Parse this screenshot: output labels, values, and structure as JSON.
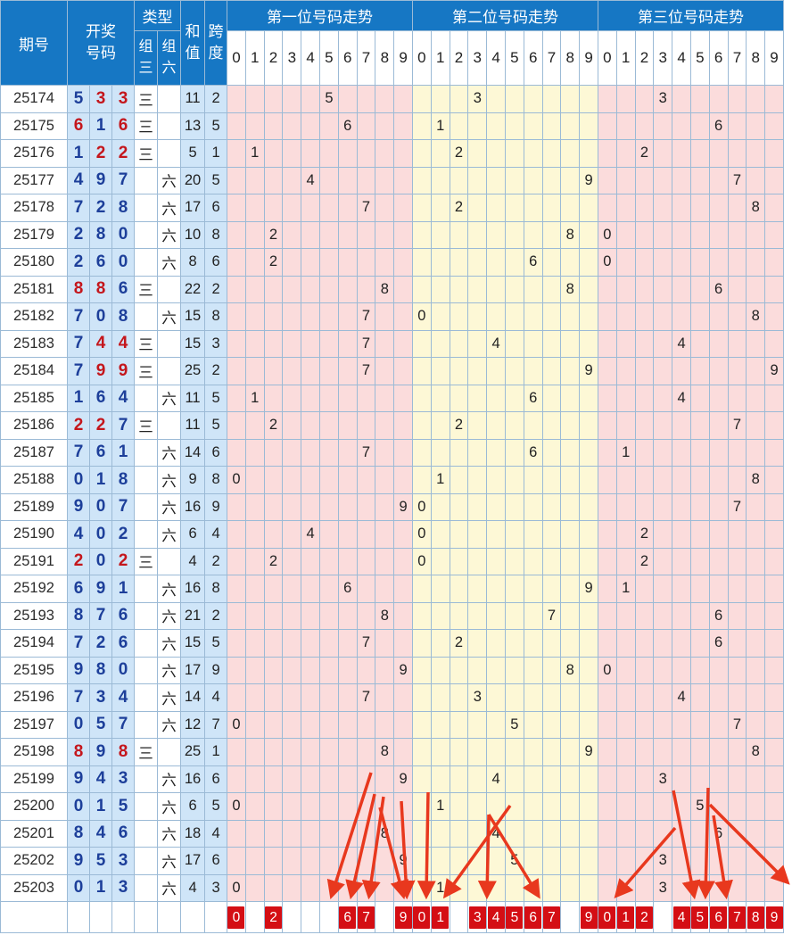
{
  "header": {
    "issue": "期号",
    "draw": [
      "开奖",
      "号码"
    ],
    "type": "类型",
    "zu3": [
      "组",
      "三"
    ],
    "zu6": [
      "组",
      "六"
    ],
    "sum": [
      "和",
      "值"
    ],
    "span": [
      "跨",
      "度"
    ],
    "groups": [
      "第一位号码走势",
      "第二位号码走势",
      "第三位号码走势"
    ],
    "digits": [
      "0",
      "1",
      "2",
      "3",
      "4",
      "5",
      "6",
      "7",
      "8",
      "9"
    ]
  },
  "rows": [
    {
      "issue": "25174",
      "draw": [
        "5",
        "3",
        "3"
      ],
      "zu3": "三",
      "zu6": "",
      "sum": "11",
      "span": "2"
    },
    {
      "issue": "25175",
      "draw": [
        "6",
        "1",
        "6"
      ],
      "zu3": "三",
      "zu6": "",
      "sum": "13",
      "span": "5"
    },
    {
      "issue": "25176",
      "draw": [
        "1",
        "2",
        "2"
      ],
      "zu3": "三",
      "zu6": "",
      "sum": "5",
      "span": "1"
    },
    {
      "issue": "25177",
      "draw": [
        "4",
        "9",
        "7"
      ],
      "zu3": "",
      "zu6": "六",
      "sum": "20",
      "span": "5"
    },
    {
      "issue": "25178",
      "draw": [
        "7",
        "2",
        "8"
      ],
      "zu3": "",
      "zu6": "六",
      "sum": "17",
      "span": "6"
    },
    {
      "issue": "25179",
      "draw": [
        "2",
        "8",
        "0"
      ],
      "zu3": "",
      "zu6": "六",
      "sum": "10",
      "span": "8"
    },
    {
      "issue": "25180",
      "draw": [
        "2",
        "6",
        "0"
      ],
      "zu3": "",
      "zu6": "六",
      "sum": "8",
      "span": "6"
    },
    {
      "issue": "25181",
      "draw": [
        "8",
        "8",
        "6"
      ],
      "zu3": "三",
      "zu6": "",
      "sum": "22",
      "span": "2"
    },
    {
      "issue": "25182",
      "draw": [
        "7",
        "0",
        "8"
      ],
      "zu3": "",
      "zu6": "六",
      "sum": "15",
      "span": "8"
    },
    {
      "issue": "25183",
      "draw": [
        "7",
        "4",
        "4"
      ],
      "zu3": "三",
      "zu6": "",
      "sum": "15",
      "span": "3"
    },
    {
      "issue": "25184",
      "draw": [
        "7",
        "9",
        "9"
      ],
      "zu3": "三",
      "zu6": "",
      "sum": "25",
      "span": "2"
    },
    {
      "issue": "25185",
      "draw": [
        "1",
        "6",
        "4"
      ],
      "zu3": "",
      "zu6": "六",
      "sum": "11",
      "span": "5"
    },
    {
      "issue": "25186",
      "draw": [
        "2",
        "2",
        "7"
      ],
      "zu3": "三",
      "zu6": "",
      "sum": "11",
      "span": "5"
    },
    {
      "issue": "25187",
      "draw": [
        "7",
        "6",
        "1"
      ],
      "zu3": "",
      "zu6": "六",
      "sum": "14",
      "span": "6"
    },
    {
      "issue": "25188",
      "draw": [
        "0",
        "1",
        "8"
      ],
      "zu3": "",
      "zu6": "六",
      "sum": "9",
      "span": "8"
    },
    {
      "issue": "25189",
      "draw": [
        "9",
        "0",
        "7"
      ],
      "zu3": "",
      "zu6": "六",
      "sum": "16",
      "span": "9"
    },
    {
      "issue": "25190",
      "draw": [
        "4",
        "0",
        "2"
      ],
      "zu3": "",
      "zu6": "六",
      "sum": "6",
      "span": "4"
    },
    {
      "issue": "25191",
      "draw": [
        "2",
        "0",
        "2"
      ],
      "zu3": "三",
      "zu6": "",
      "sum": "4",
      "span": "2"
    },
    {
      "issue": "25192",
      "draw": [
        "6",
        "9",
        "1"
      ],
      "zu3": "",
      "zu6": "六",
      "sum": "16",
      "span": "8"
    },
    {
      "issue": "25193",
      "draw": [
        "8",
        "7",
        "6"
      ],
      "zu3": "",
      "zu6": "六",
      "sum": "21",
      "span": "2"
    },
    {
      "issue": "25194",
      "draw": [
        "7",
        "2",
        "6"
      ],
      "zu3": "",
      "zu6": "六",
      "sum": "15",
      "span": "5"
    },
    {
      "issue": "25195",
      "draw": [
        "9",
        "8",
        "0"
      ],
      "zu3": "",
      "zu6": "六",
      "sum": "17",
      "span": "9"
    },
    {
      "issue": "25196",
      "draw": [
        "7",
        "3",
        "4"
      ],
      "zu3": "",
      "zu6": "六",
      "sum": "14",
      "span": "4"
    },
    {
      "issue": "25197",
      "draw": [
        "0",
        "5",
        "7"
      ],
      "zu3": "",
      "zu6": "六",
      "sum": "12",
      "span": "7"
    },
    {
      "issue": "25198",
      "draw": [
        "8",
        "9",
        "8"
      ],
      "zu3": "三",
      "zu6": "",
      "sum": "25",
      "span": "1"
    },
    {
      "issue": "25199",
      "draw": [
        "9",
        "4",
        "3"
      ],
      "zu3": "",
      "zu6": "六",
      "sum": "16",
      "span": "6"
    },
    {
      "issue": "25200",
      "draw": [
        "0",
        "1",
        "5"
      ],
      "zu3": "",
      "zu6": "六",
      "sum": "6",
      "span": "5"
    },
    {
      "issue": "25201",
      "draw": [
        "8",
        "4",
        "6"
      ],
      "zu3": "",
      "zu6": "六",
      "sum": "18",
      "span": "4"
    },
    {
      "issue": "25202",
      "draw": [
        "9",
        "5",
        "3"
      ],
      "zu3": "",
      "zu6": "六",
      "sum": "17",
      "span": "6"
    },
    {
      "issue": "25203",
      "draw": [
        "0",
        "1",
        "3"
      ],
      "zu3": "",
      "zu6": "六",
      "sum": "4",
      "span": "3"
    }
  ],
  "selection": {
    "pos1": [
      "0",
      "",
      "2",
      "",
      "",
      "",
      "6",
      "7",
      "",
      "9"
    ],
    "pos2": [
      "0",
      "1",
      "",
      "3",
      "4",
      "5",
      "6",
      "7",
      "",
      "9"
    ],
    "pos3": [
      "0",
      "1",
      "2",
      "",
      "4",
      "5",
      "6",
      "7",
      "8",
      "9"
    ]
  },
  "colors": {
    "header_blue": "#1677c4",
    "light_blue": "#cfe5f8",
    "pink": "#fbdcdc",
    "cream": "#fdf8d6",
    "red": "#c4161c",
    "blue_digit": "#1d3f9a",
    "arrow": "#e8381e"
  }
}
